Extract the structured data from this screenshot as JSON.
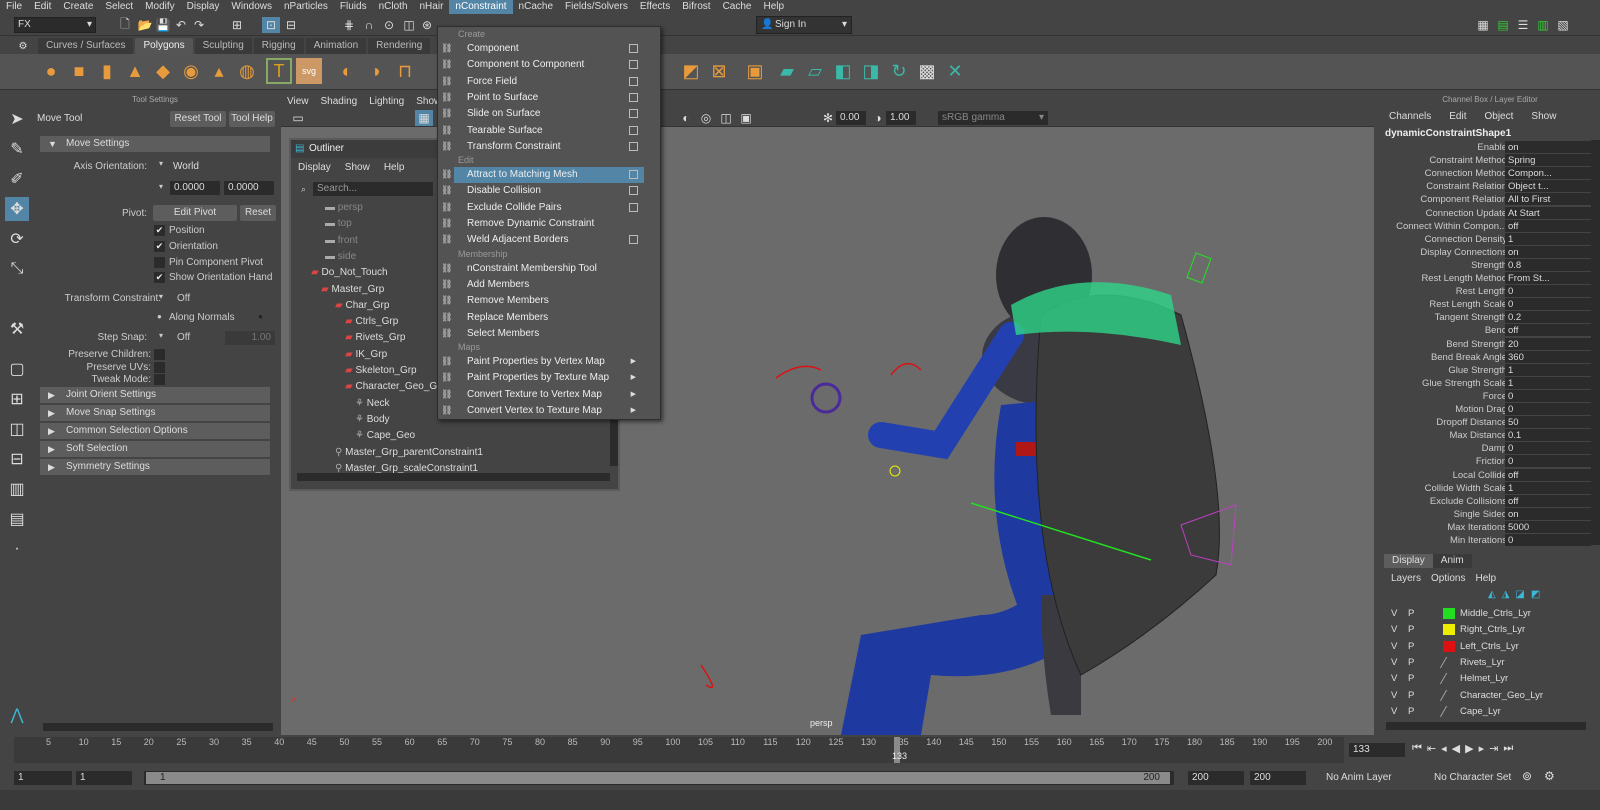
{
  "menubar": [
    "File",
    "Edit",
    "Create",
    "Select",
    "Modify",
    "Display",
    "Windows",
    "nParticles",
    "Fluids",
    "nCloth",
    "nHair",
    "nConstraint",
    "nCache",
    "Fields/Solvers",
    "Effects",
    "Bifrost",
    "Cache",
    "Help"
  ],
  "status": {
    "mode": "FX",
    "signin": "Sign In"
  },
  "shelf_tabs": [
    "Curves / Surfaces",
    "Polygons",
    "Sculpting",
    "Rigging",
    "Animation",
    "Rendering"
  ],
  "tool_settings": {
    "header": "Tool Settings",
    "tool_name": "Move Tool",
    "reset": "Reset Tool",
    "help": "Tool Help",
    "move_settings": "Move Settings",
    "axis_orientation_label": "Axis Orientation:",
    "axis_orientation": "World",
    "val1": "0.0000",
    "val2": "0.0000",
    "pivot_label": "Pivot:",
    "edit_pivot": "Edit Pivot",
    "reset_btn": "Reset",
    "position": "Position",
    "orientation": "Orientation",
    "pin_pivot": "Pin Component Pivot",
    "show_orient": "Show Orientation Handl",
    "transform_constraint_label": "Transform Constraint:",
    "transform_constraint": "Off",
    "along_normals": "Along Normals",
    "step_snap_label": "Step Snap:",
    "step_snap": "Off",
    "step_val": "1.00",
    "preserve_children": "Preserve Children:",
    "preserve_uvs": "Preserve UVs:",
    "tweak_mode": "Tweak Mode:",
    "sections": [
      "Joint Orient Settings",
      "Move Snap Settings",
      "Common Selection Options",
      "Soft Selection",
      "Symmetry Settings"
    ]
  },
  "viewport": {
    "menu": [
      "View",
      "Shading",
      "Lighting",
      "Show"
    ],
    "field1": "0.00",
    "field2": "1.00",
    "gamma": "sRGB gamma",
    "camera": "persp"
  },
  "outliner": {
    "title": "Outliner",
    "menu": [
      "Display",
      "Show",
      "Help"
    ],
    "search": "Search...",
    "items": [
      "persp",
      "top",
      "front",
      "side",
      "Do_Not_Touch",
      "Master_Grp",
      "Char_Grp",
      "Ctrls_Grp",
      "Rivets_Grp",
      "IK_Grp",
      "Skeleton_Grp",
      "Character_Geo_G",
      "Neck",
      "Body",
      "Cape_Geo",
      "Master_Grp_parentConstraint1",
      "Master_Grp_scaleConstraint1"
    ]
  },
  "dropdown": {
    "headers": [
      "Create",
      "Edit",
      "Membership",
      "Maps"
    ],
    "create": [
      "Component",
      "Component to Component",
      "Force Field",
      "Point to Surface",
      "Slide on Surface",
      "Tearable Surface",
      "Transform Constraint"
    ],
    "edit": [
      "Attract to Matching Mesh",
      "Disable Collision",
      "Exclude Collide Pairs",
      "Remove Dynamic Constraint",
      "Weld Adjacent Borders"
    ],
    "membership": [
      "nConstraint Membership Tool",
      "Add Members",
      "Remove Members",
      "Replace Members",
      "Select Members"
    ],
    "maps": [
      "Paint Properties by Vertex Map",
      "Paint Properties by Texture Map",
      "Convert Texture to Vertex Map",
      "Convert Vertex to Texture Map"
    ]
  },
  "channel_box": {
    "header": "Channel Box / Layer Editor",
    "menu": [
      "Channels",
      "Edit",
      "Object",
      "Show"
    ],
    "node": "dynamicConstraintShape1",
    "attrs": [
      [
        "Enable",
        "on"
      ],
      [
        "Constraint Method",
        "Spring"
      ],
      [
        "Connection Method",
        "Compon..."
      ],
      [
        "Constraint Relation",
        "Object t..."
      ],
      [
        "Component Relation",
        "All to First"
      ],
      [
        "Connection Update",
        "At Start"
      ],
      [
        "Connect Within Compon...",
        "off"
      ],
      [
        "Connection Density",
        "1"
      ],
      [
        "Display Connections",
        "on"
      ],
      [
        "Strength",
        "0.8"
      ],
      [
        "Rest Length Method",
        "From St..."
      ],
      [
        "Rest Length",
        "0"
      ],
      [
        "Rest Length Scale",
        "0"
      ],
      [
        "Tangent Strength",
        "0.2"
      ],
      [
        "Bend",
        "off"
      ],
      [
        "Bend Strength",
        "20"
      ],
      [
        "Bend Break Angle",
        "360"
      ],
      [
        "Glue Strength",
        "1"
      ],
      [
        "Glue Strength Scale",
        "1"
      ],
      [
        "Force",
        "0"
      ],
      [
        "Motion Drag",
        "0"
      ],
      [
        "Dropoff Distance",
        "50"
      ],
      [
        "Max Distance",
        "0.1"
      ],
      [
        "Damp",
        "0"
      ],
      [
        "Friction",
        "0"
      ],
      [
        "Local Collide",
        "off"
      ],
      [
        "Collide Width Scale",
        "1"
      ],
      [
        "Exclude Collisions",
        "off"
      ],
      [
        "Single Sided",
        "on"
      ],
      [
        "Max Iterations",
        "5000"
      ],
      [
        "Min Iterations",
        "0"
      ]
    ]
  },
  "layer_editor": {
    "tabs": [
      "Display",
      "Anim"
    ],
    "menu": [
      "Layers",
      "Options",
      "Help"
    ],
    "layers": [
      [
        "Middle_Ctrls_Lyr",
        "#22dd22"
      ],
      [
        "Right_Ctrls_Lyr",
        "#eeee00"
      ],
      [
        "Left_Ctrls_Lyr",
        "#dd1111"
      ],
      [
        "Rivets_Lyr",
        ""
      ],
      [
        "Helmet_Lyr",
        ""
      ],
      [
        "Character_Geo_Lyr",
        ""
      ],
      [
        "Cape_Lyr",
        ""
      ]
    ]
  },
  "timeline": {
    "ticks": [
      "5",
      "10",
      "15",
      "20",
      "25",
      "30",
      "35",
      "40",
      "45",
      "50",
      "55",
      "60",
      "65",
      "70",
      "75",
      "80",
      "85",
      "90",
      "95",
      "100",
      "105",
      "110",
      "115",
      "120",
      "125",
      "130",
      "135",
      "140",
      "145",
      "150",
      "155",
      "160",
      "165",
      "170",
      "175",
      "180",
      "185",
      "190",
      "195",
      "200"
    ],
    "current": "133",
    "current_field": "133"
  },
  "range": {
    "start": "1",
    "start2": "1",
    "range_start": "1",
    "range_end": "200",
    "end": "200",
    "end2": "200",
    "anim_layer": "No Anim Layer",
    "char_set": "No Character Set"
  }
}
